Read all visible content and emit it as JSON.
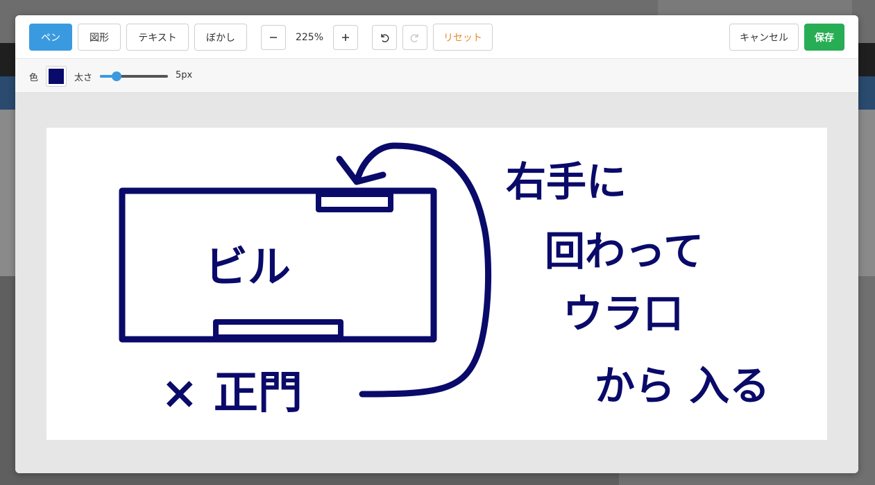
{
  "toolbar": {
    "tools": [
      {
        "label": "ペン",
        "active": true
      },
      {
        "label": "図形",
        "active": false
      },
      {
        "label": "テキスト",
        "active": false
      },
      {
        "label": "ぼかし",
        "active": false
      }
    ],
    "zoom_out_icon": "minus-icon",
    "zoom_in_icon": "plus-icon",
    "zoom_level": "225%",
    "undo_icon": "undo-icon",
    "redo_icon": "redo-icon",
    "reset_label": "リセット",
    "cancel_label": "キャンセル",
    "save_label": "保存"
  },
  "pen_options": {
    "color_label": "色",
    "color": "#0a0a6a",
    "width_label": "太さ",
    "width_value": "5px",
    "width_fraction": 0.2
  },
  "colors": {
    "accent": "#3a9ae0",
    "save": "#27ae55",
    "reset": "#e8892c",
    "ink": "#0a0a6a"
  },
  "drawing": {
    "building_label": "ビル",
    "main_gate_label": "× 正門",
    "instruction_lines": [
      "右手に",
      "回わって",
      "ウラ口",
      "から 入る"
    ]
  }
}
